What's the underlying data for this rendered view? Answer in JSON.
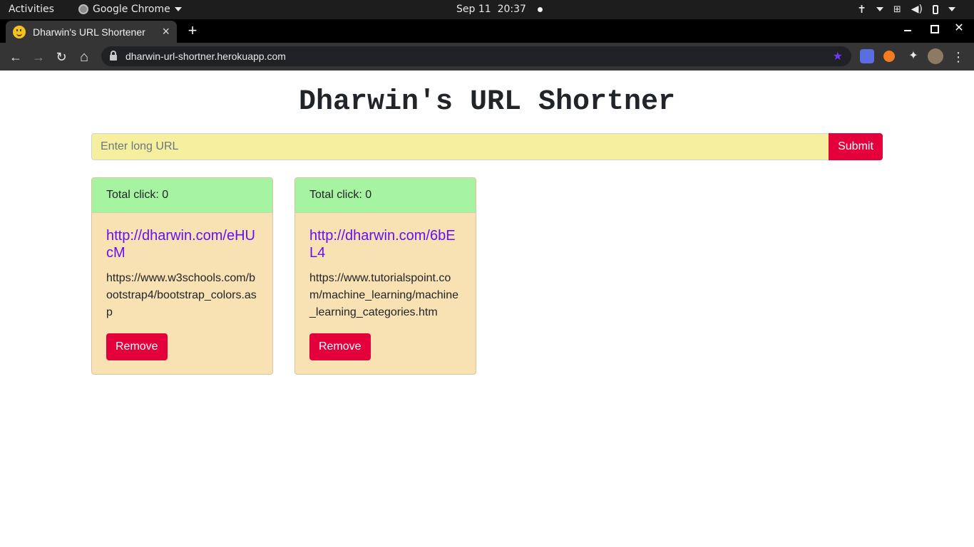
{
  "system_bar": {
    "activities": "Activities",
    "app_name": "Google Chrome",
    "date": "Sep 11",
    "time": "20:37"
  },
  "browser": {
    "tab_title": "Dharwin's URL Shortener",
    "tab_close": "×",
    "new_tab": "+",
    "url": "dharwin-url-shortner.herokuapp.com",
    "back": "←",
    "forward": "→",
    "reload": "↻",
    "home": "⌂",
    "menu": "⋮",
    "bookmark_star": "★"
  },
  "page": {
    "title": "Dharwin's URL Shortner",
    "input_placeholder": "Enter long URL",
    "submit_label": "Submit",
    "cards": [
      {
        "clicks": "Total click: 0",
        "short_url": "http://dharwin.com/eHUcM",
        "long_url": "https://www.w3schools.com/bootstrap4/bootstrap_colors.asp",
        "remove_label": "Remove"
      },
      {
        "clicks": "Total click: 0",
        "short_url": "http://dharwin.com/6bEL4",
        "long_url": "https://www.tutorialspoint.com/machine_learning/machine_learning_categories.htm",
        "remove_label": "Remove"
      }
    ]
  },
  "colors": {
    "input_bg": "#f5ef9f",
    "danger": "#e4003a",
    "card_header_bg": "#a6f4a2",
    "card_body_bg": "#f8e1b3",
    "link": "#6610f2"
  }
}
